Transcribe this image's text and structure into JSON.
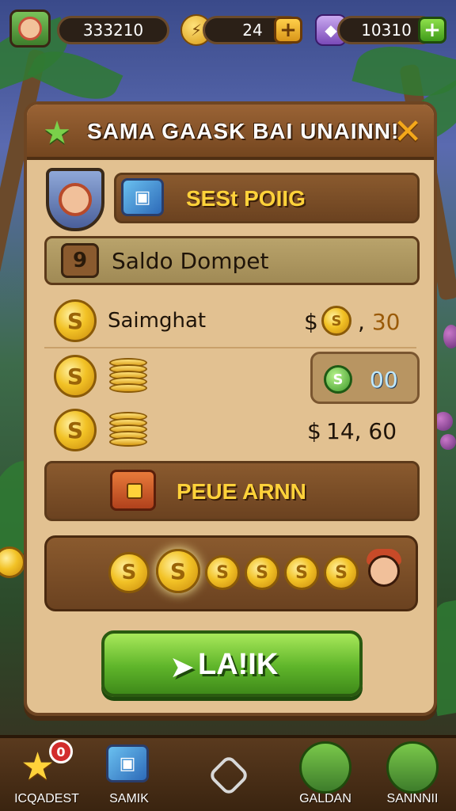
{
  "top_bar": {
    "avatar_badge": "",
    "coins_value": "333210",
    "gems_value": "24",
    "gem_plus": "+",
    "chest_value": "10310",
    "chest_plus": "+"
  },
  "panel": {
    "title": "SAMA GAASK BAI UNAINN!",
    "close": "✕",
    "banner_top_label": "SESt POIIG",
    "wallet_number": "9",
    "wallet_label": "Saldo Dompet",
    "rows": [
      {
        "label": "Saimghat",
        "currency_symbol": "$",
        "value": "30"
      },
      {
        "label": "",
        "currency_symbol": "",
        "value": "00"
      },
      {
        "label": "",
        "currency_symbol": "$",
        "value": "14, 60"
      }
    ],
    "banner_bottom_label": "PEUE ARNN",
    "cta_label": "LA!IK",
    "coin_glyph": "S"
  },
  "bottom_nav": {
    "items": [
      {
        "label": "ICQADEST",
        "badge": "0"
      },
      {
        "label": "SAMIK",
        "badge": ""
      },
      {
        "label": "",
        "badge": ""
      },
      {
        "label": "GALDAN",
        "badge": ""
      },
      {
        "label": "SANNNII",
        "badge": ""
      }
    ]
  },
  "colors": {
    "panel": "#e2c191",
    "panel_border": "#6e4522",
    "gold": "#ffd23a",
    "cta_green": "#5fb52a",
    "badge_red": "#d22d2d"
  },
  "icons": [
    "avatar-icon",
    "coin-icon",
    "gem-icon",
    "chest-icon",
    "star-icon",
    "close-icon",
    "shield-avatar-icon",
    "box-icon",
    "home-icon"
  ]
}
